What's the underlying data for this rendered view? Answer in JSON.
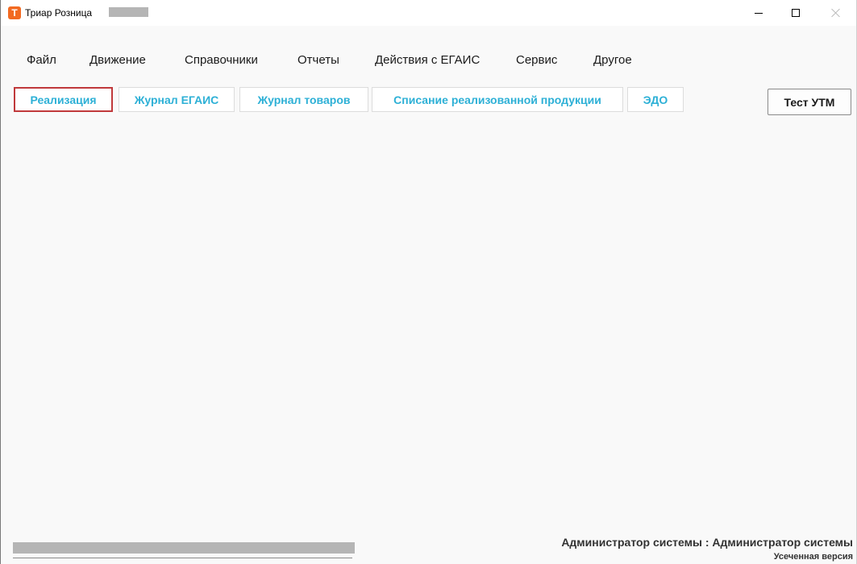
{
  "window": {
    "title": "Триар Розница",
    "icon": "triar-app-icon",
    "controls": [
      "minimize-icon",
      "maximize-icon",
      "close-icon"
    ]
  },
  "menu": {
    "items": [
      {
        "label": "Файл"
      },
      {
        "label": "Движение"
      },
      {
        "label": "Справочники"
      },
      {
        "label": "Отчеты"
      },
      {
        "label": "Действия с ЕГАИС"
      },
      {
        "label": "Сервис"
      },
      {
        "label": "Другое"
      }
    ]
  },
  "toolbar": {
    "buttons": [
      {
        "label": "Реализация",
        "active": true
      },
      {
        "label": "Журнал ЕГАИС"
      },
      {
        "label": "Журнал товаров"
      },
      {
        "label": "Списание реализованной продукции"
      },
      {
        "label": "ЭДО"
      }
    ],
    "test_label": "Тест УТМ"
  },
  "status": {
    "user": "Администратор системы : Администратор системы",
    "version": "Усеченная версия"
  },
  "colors": {
    "accent": "#2db0d6",
    "active_border": "#c0393b",
    "app_icon": "#f26a21"
  }
}
